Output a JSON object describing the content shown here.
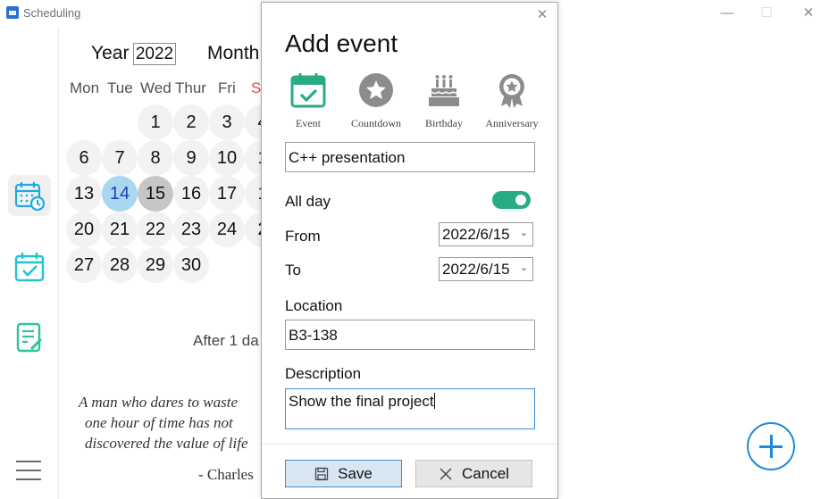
{
  "window": {
    "title": "Scheduling",
    "minimize": "—",
    "maximize": "☐",
    "close": "✕"
  },
  "calendar": {
    "year_label": "Year",
    "year_value": "2022",
    "month_label": "Month",
    "weekdays": [
      "Mon",
      "Tue",
      "Wed",
      "Thur",
      "Fri",
      "S"
    ],
    "days": [
      "1",
      "2",
      "3",
      "4",
      "6",
      "7",
      "8",
      "9",
      "10",
      "1",
      "13",
      "14",
      "15",
      "16",
      "17",
      "1",
      "20",
      "21",
      "22",
      "23",
      "24",
      "2",
      "27",
      "28",
      "29",
      "30"
    ],
    "today": "14",
    "selected": "15",
    "after_text": "After 1 da",
    "quote_lines": [
      "A man who dares to waste",
      "one hour of time has not",
      "discovered the value of life"
    ],
    "quote_author": "- Charles"
  },
  "rail": {
    "items": [
      {
        "name": "calendar-clock-icon",
        "active": true
      },
      {
        "name": "calendar-check-icon",
        "active": false
      },
      {
        "name": "notes-edit-icon",
        "active": false
      }
    ]
  },
  "dialog": {
    "title": "Add event",
    "close": "✕",
    "types": [
      {
        "label": "Event",
        "icon": "calendar-check-icon"
      },
      {
        "label": "Countdown",
        "icon": "star-icon"
      },
      {
        "label": "Birthday",
        "icon": "cake-icon"
      },
      {
        "label": "Anniversary",
        "icon": "award-icon"
      }
    ],
    "event_name": "C++ presentation",
    "all_day_label": "All day",
    "all_day": true,
    "from_label": "From",
    "from_value": "2022/6/15",
    "to_label": "To",
    "to_value": "2022/6/15",
    "location_label": "Location",
    "location_value": "B3-138",
    "description_label": "Description",
    "description_value": "Show the final project",
    "save_label": "Save",
    "cancel_label": "Cancel"
  },
  "colors": {
    "accent": "#2aab86",
    "focus": "#3d8fd8",
    "today": "#a9d7ef",
    "selected": "#c6c6c6",
    "fab": "#1e8ad6",
    "sunday": "#e24a4a"
  }
}
